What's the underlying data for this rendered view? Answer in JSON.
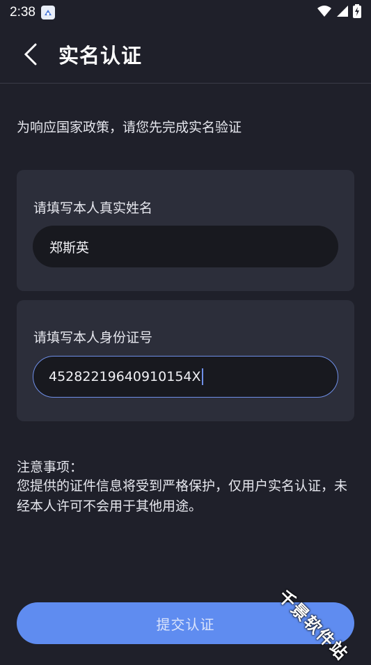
{
  "status_bar": {
    "time": "2:38"
  },
  "header": {
    "title": "实名认证"
  },
  "intro": "为响应国家政策，请您先完成实名验证",
  "name_card": {
    "label": "请填写本人真实姓名",
    "value": "郑斯英"
  },
  "id_card": {
    "label": "请填写本人身份证号",
    "value": "45282219640910154X"
  },
  "notes": {
    "title": "注意事项：",
    "body": "您提供的证件信息将受到严格保护，仅用户实名认证，未经本人许可不会用于其他用途。"
  },
  "submit_label": "提交认证",
  "watermark": "千景软件站",
  "colors": {
    "background": "#1f202a",
    "card": "#2c2e3a",
    "accent": "#5f8cf0"
  }
}
